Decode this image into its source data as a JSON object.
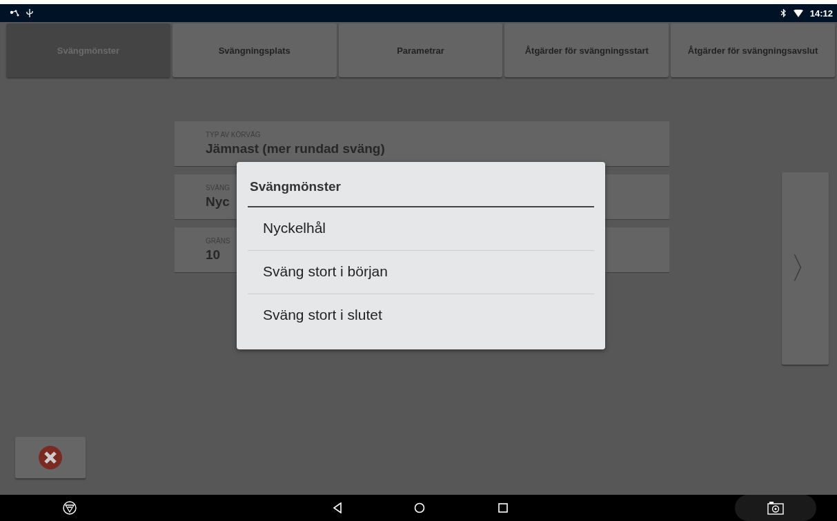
{
  "status_bar": {
    "time": "14:12"
  },
  "tabs": [
    {
      "label": "Svängmönster",
      "selected": true
    },
    {
      "label": "Svängningsplats",
      "selected": false
    },
    {
      "label": "Parametrar",
      "selected": false
    },
    {
      "label": "Åtgärder för svängningsstart",
      "selected": false
    },
    {
      "label": "Åtgärder för svängningsavslut",
      "selected": false
    }
  ],
  "fields": [
    {
      "label": "TYP AV KÖRVÄG",
      "value": "Jämnast (mer rundad sväng)"
    },
    {
      "label": "SVÄNG",
      "value": "Nyc"
    },
    {
      "label": "GRÄNS",
      "value": "10"
    }
  ],
  "next_button": {
    "glyph": "〉"
  },
  "dialog": {
    "title": "Svängmönster",
    "options": [
      "Nyckelhål",
      "Sväng stort i början",
      "Sväng stort i slutet"
    ]
  }
}
